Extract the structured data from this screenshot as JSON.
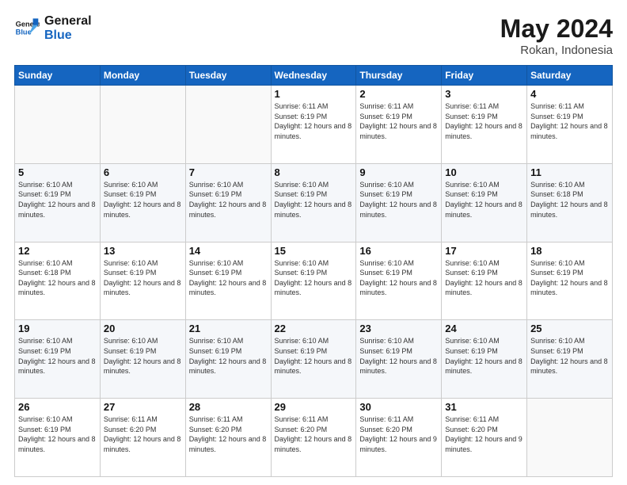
{
  "logo": {
    "line1": "General",
    "line2": "Blue"
  },
  "title": "May 2024",
  "location": "Rokan, Indonesia",
  "days_header": [
    "Sunday",
    "Monday",
    "Tuesday",
    "Wednesday",
    "Thursday",
    "Friday",
    "Saturday"
  ],
  "weeks": [
    [
      {
        "day": "",
        "sunrise": "",
        "sunset": "",
        "daylight": "",
        "empty": true
      },
      {
        "day": "",
        "sunrise": "",
        "sunset": "",
        "daylight": "",
        "empty": true
      },
      {
        "day": "",
        "sunrise": "",
        "sunset": "",
        "daylight": "",
        "empty": true
      },
      {
        "day": "1",
        "sunrise": "Sunrise: 6:11 AM",
        "sunset": "Sunset: 6:19 PM",
        "daylight": "Daylight: 12 hours and 8 minutes.",
        "empty": false
      },
      {
        "day": "2",
        "sunrise": "Sunrise: 6:11 AM",
        "sunset": "Sunset: 6:19 PM",
        "daylight": "Daylight: 12 hours and 8 minutes.",
        "empty": false
      },
      {
        "day": "3",
        "sunrise": "Sunrise: 6:11 AM",
        "sunset": "Sunset: 6:19 PM",
        "daylight": "Daylight: 12 hours and 8 minutes.",
        "empty": false
      },
      {
        "day": "4",
        "sunrise": "Sunrise: 6:11 AM",
        "sunset": "Sunset: 6:19 PM",
        "daylight": "Daylight: 12 hours and 8 minutes.",
        "empty": false
      }
    ],
    [
      {
        "day": "5",
        "sunrise": "Sunrise: 6:10 AM",
        "sunset": "Sunset: 6:19 PM",
        "daylight": "Daylight: 12 hours and 8 minutes.",
        "empty": false
      },
      {
        "day": "6",
        "sunrise": "Sunrise: 6:10 AM",
        "sunset": "Sunset: 6:19 PM",
        "daylight": "Daylight: 12 hours and 8 minutes.",
        "empty": false
      },
      {
        "day": "7",
        "sunrise": "Sunrise: 6:10 AM",
        "sunset": "Sunset: 6:19 PM",
        "daylight": "Daylight: 12 hours and 8 minutes.",
        "empty": false
      },
      {
        "day": "8",
        "sunrise": "Sunrise: 6:10 AM",
        "sunset": "Sunset: 6:19 PM",
        "daylight": "Daylight: 12 hours and 8 minutes.",
        "empty": false
      },
      {
        "day": "9",
        "sunrise": "Sunrise: 6:10 AM",
        "sunset": "Sunset: 6:19 PM",
        "daylight": "Daylight: 12 hours and 8 minutes.",
        "empty": false
      },
      {
        "day": "10",
        "sunrise": "Sunrise: 6:10 AM",
        "sunset": "Sunset: 6:19 PM",
        "daylight": "Daylight: 12 hours and 8 minutes.",
        "empty": false
      },
      {
        "day": "11",
        "sunrise": "Sunrise: 6:10 AM",
        "sunset": "Sunset: 6:18 PM",
        "daylight": "Daylight: 12 hours and 8 minutes.",
        "empty": false
      }
    ],
    [
      {
        "day": "12",
        "sunrise": "Sunrise: 6:10 AM",
        "sunset": "Sunset: 6:18 PM",
        "daylight": "Daylight: 12 hours and 8 minutes.",
        "empty": false
      },
      {
        "day": "13",
        "sunrise": "Sunrise: 6:10 AM",
        "sunset": "Sunset: 6:19 PM",
        "daylight": "Daylight: 12 hours and 8 minutes.",
        "empty": false
      },
      {
        "day": "14",
        "sunrise": "Sunrise: 6:10 AM",
        "sunset": "Sunset: 6:19 PM",
        "daylight": "Daylight: 12 hours and 8 minutes.",
        "empty": false
      },
      {
        "day": "15",
        "sunrise": "Sunrise: 6:10 AM",
        "sunset": "Sunset: 6:19 PM",
        "daylight": "Daylight: 12 hours and 8 minutes.",
        "empty": false
      },
      {
        "day": "16",
        "sunrise": "Sunrise: 6:10 AM",
        "sunset": "Sunset: 6:19 PM",
        "daylight": "Daylight: 12 hours and 8 minutes.",
        "empty": false
      },
      {
        "day": "17",
        "sunrise": "Sunrise: 6:10 AM",
        "sunset": "Sunset: 6:19 PM",
        "daylight": "Daylight: 12 hours and 8 minutes.",
        "empty": false
      },
      {
        "day": "18",
        "sunrise": "Sunrise: 6:10 AM",
        "sunset": "Sunset: 6:19 PM",
        "daylight": "Daylight: 12 hours and 8 minutes.",
        "empty": false
      }
    ],
    [
      {
        "day": "19",
        "sunrise": "Sunrise: 6:10 AM",
        "sunset": "Sunset: 6:19 PM",
        "daylight": "Daylight: 12 hours and 8 minutes.",
        "empty": false
      },
      {
        "day": "20",
        "sunrise": "Sunrise: 6:10 AM",
        "sunset": "Sunset: 6:19 PM",
        "daylight": "Daylight: 12 hours and 8 minutes.",
        "empty": false
      },
      {
        "day": "21",
        "sunrise": "Sunrise: 6:10 AM",
        "sunset": "Sunset: 6:19 PM",
        "daylight": "Daylight: 12 hours and 8 minutes.",
        "empty": false
      },
      {
        "day": "22",
        "sunrise": "Sunrise: 6:10 AM",
        "sunset": "Sunset: 6:19 PM",
        "daylight": "Daylight: 12 hours and 8 minutes.",
        "empty": false
      },
      {
        "day": "23",
        "sunrise": "Sunrise: 6:10 AM",
        "sunset": "Sunset: 6:19 PM",
        "daylight": "Daylight: 12 hours and 8 minutes.",
        "empty": false
      },
      {
        "day": "24",
        "sunrise": "Sunrise: 6:10 AM",
        "sunset": "Sunset: 6:19 PM",
        "daylight": "Daylight: 12 hours and 8 minutes.",
        "empty": false
      },
      {
        "day": "25",
        "sunrise": "Sunrise: 6:10 AM",
        "sunset": "Sunset: 6:19 PM",
        "daylight": "Daylight: 12 hours and 8 minutes.",
        "empty": false
      }
    ],
    [
      {
        "day": "26",
        "sunrise": "Sunrise: 6:10 AM",
        "sunset": "Sunset: 6:19 PM",
        "daylight": "Daylight: 12 hours and 8 minutes.",
        "empty": false
      },
      {
        "day": "27",
        "sunrise": "Sunrise: 6:11 AM",
        "sunset": "Sunset: 6:20 PM",
        "daylight": "Daylight: 12 hours and 8 minutes.",
        "empty": false
      },
      {
        "day": "28",
        "sunrise": "Sunrise: 6:11 AM",
        "sunset": "Sunset: 6:20 PM",
        "daylight": "Daylight: 12 hours and 8 minutes.",
        "empty": false
      },
      {
        "day": "29",
        "sunrise": "Sunrise: 6:11 AM",
        "sunset": "Sunset: 6:20 PM",
        "daylight": "Daylight: 12 hours and 8 minutes.",
        "empty": false
      },
      {
        "day": "30",
        "sunrise": "Sunrise: 6:11 AM",
        "sunset": "Sunset: 6:20 PM",
        "daylight": "Daylight: 12 hours and 9 minutes.",
        "empty": false
      },
      {
        "day": "31",
        "sunrise": "Sunrise: 6:11 AM",
        "sunset": "Sunset: 6:20 PM",
        "daylight": "Daylight: 12 hours and 9 minutes.",
        "empty": false
      },
      {
        "day": "",
        "sunrise": "",
        "sunset": "",
        "daylight": "",
        "empty": true
      }
    ]
  ]
}
